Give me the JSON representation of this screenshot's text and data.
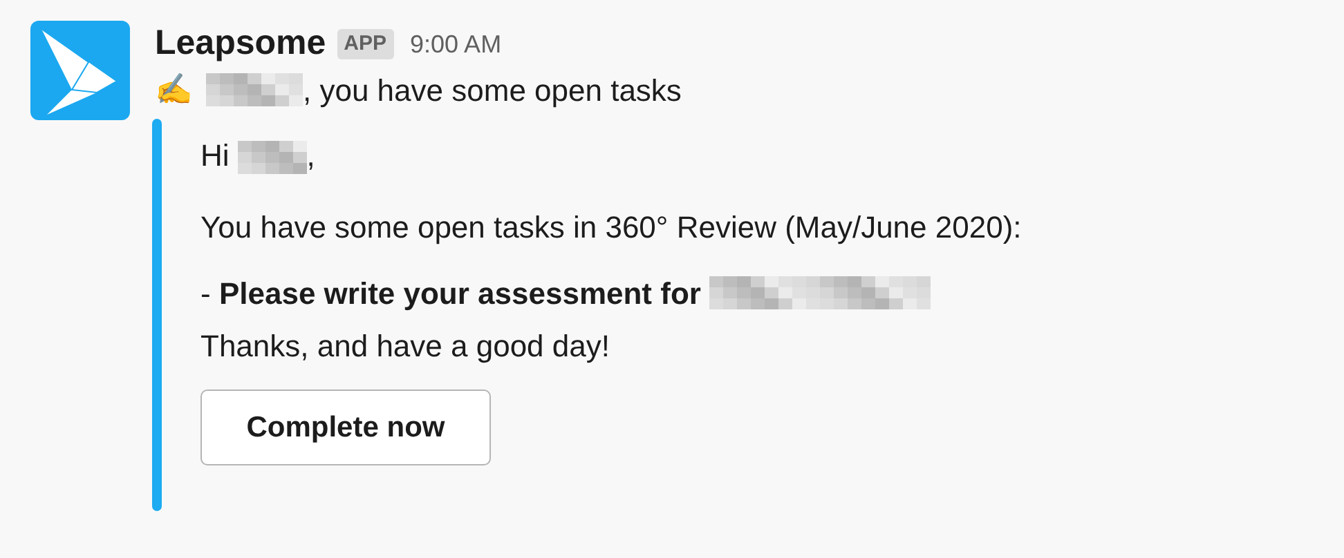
{
  "message": {
    "sender": "Leapsome",
    "badge": "APP",
    "time": "9:00 AM",
    "emoji": "✍️",
    "headline": ", you have some open tasks"
  },
  "attachment": {
    "greeting": "Hi",
    "greeting_end": ",",
    "intro": "You have some open tasks in 360° Review (May/June 2020):",
    "task": "- **Please write your assessment for**",
    "closing": "Thanks, and have a good day!",
    "button": "Complete now"
  }
}
